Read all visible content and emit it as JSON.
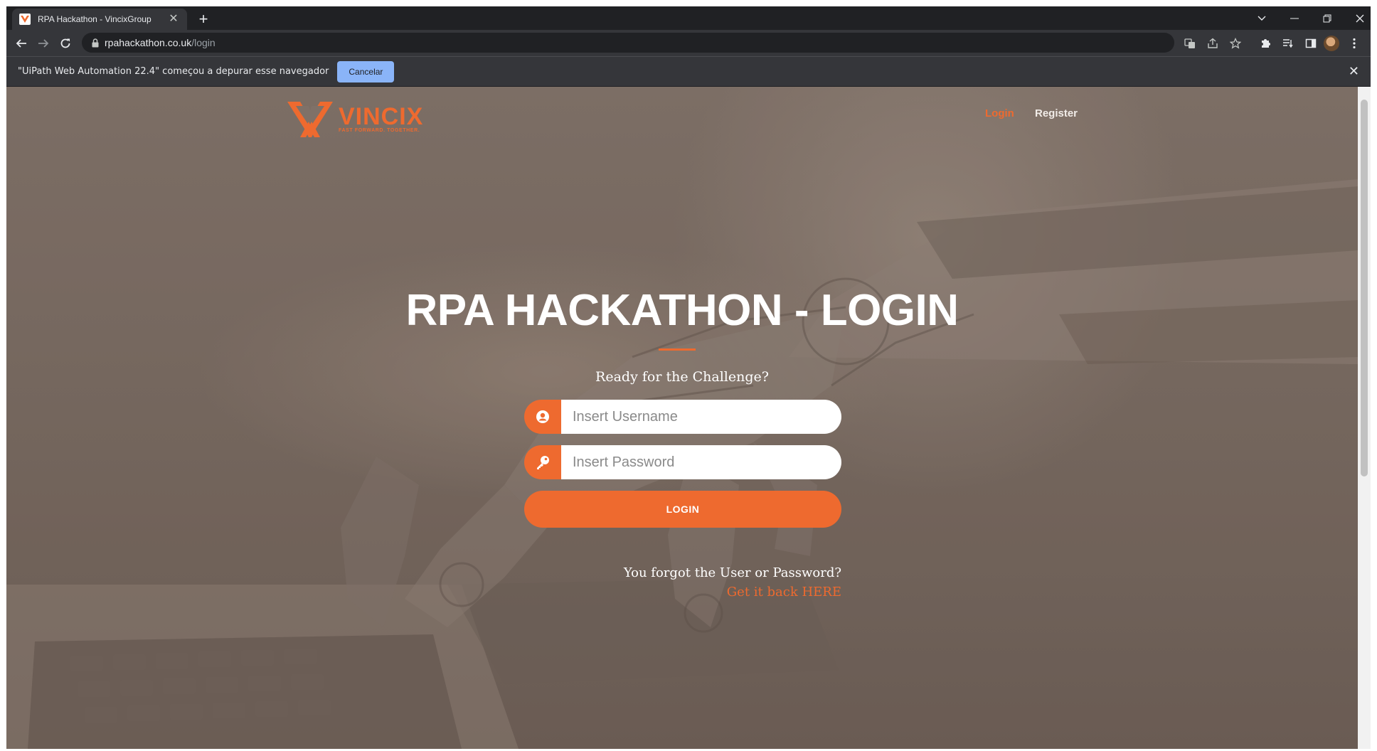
{
  "browser": {
    "tab_title": "RPA Hackathon - VincixGroup",
    "tab_close": "✕",
    "new_tab": "+",
    "url_host": "rpahackathon.co.uk",
    "url_path": "/login"
  },
  "infobar": {
    "message": "\"UiPath Web Automation 22.4\" começou a depurar esse navegador",
    "cancel_label": "Cancelar",
    "close": "✕"
  },
  "site": {
    "brand_name": "VINCIX",
    "brand_tagline": "FAST FORWARD. TOGETHER.",
    "nav": {
      "login_label": "Login",
      "register_label": "Register"
    },
    "hero_title": "RPA HACKATHON - LOGIN",
    "subtitle": "Ready for the Challenge?",
    "username_placeholder": "Insert Username",
    "password_placeholder": "Insert Password",
    "login_button": "LOGIN",
    "forgot_question": "You forgot the User or Password?",
    "forgot_link": "Get it back HERE"
  },
  "colors": {
    "accent": "#ee6a2f",
    "infobar_button": "#8ab4f8",
    "browser_dark": "#202124",
    "browser_toolbar": "#35363a"
  },
  "icons": {
    "favicon": "vincix-favicon-icon",
    "username": "user-circle-icon",
    "password": "key-icon"
  }
}
